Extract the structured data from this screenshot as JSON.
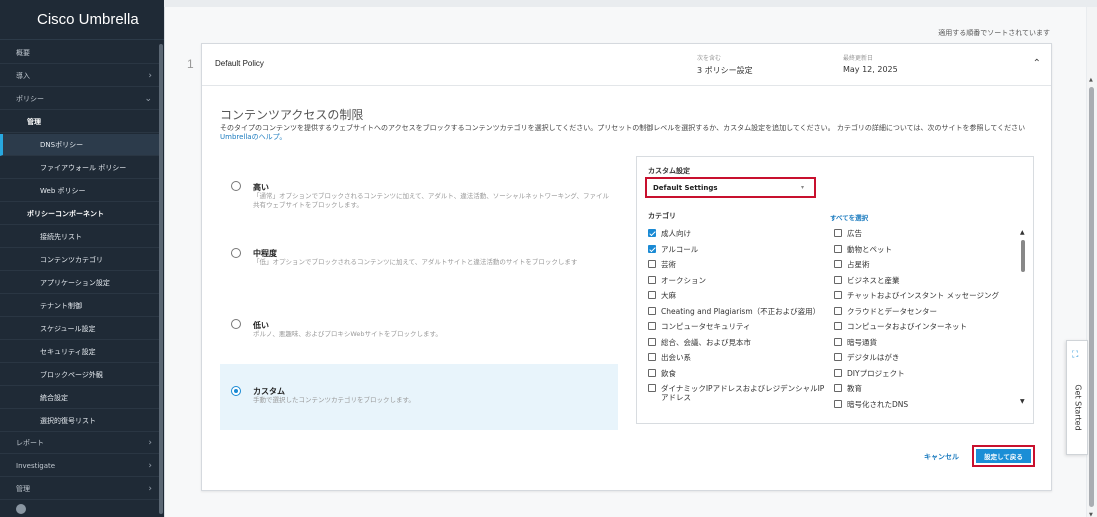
{
  "sidebar": {
    "brand": "Cisco Umbrella",
    "items": [
      {
        "label": "概要"
      },
      {
        "label": "導入"
      },
      {
        "label": "ポリシー"
      },
      {
        "label": "管理"
      },
      {
        "label": "DNSポリシー"
      },
      {
        "label": "ファイアウォール ポリシー"
      },
      {
        "label": "Web ポリシー"
      },
      {
        "label": "ポリシーコンポーネント"
      },
      {
        "label": "接続先リスト"
      },
      {
        "label": "コンテンツカテゴリ"
      },
      {
        "label": "アプリケーション設定"
      },
      {
        "label": "テナント制御"
      },
      {
        "label": "スケジュール設定"
      },
      {
        "label": "セキュリティ設定"
      },
      {
        "label": "ブロックページ外観"
      },
      {
        "label": "統合設定"
      },
      {
        "label": "選択的復号リスト"
      },
      {
        "label": "レポート"
      },
      {
        "label": "Investigate"
      },
      {
        "label": "管理"
      }
    ]
  },
  "main": {
    "sort_note": "適用する順番でソートされています",
    "row_number": "1",
    "policy": {
      "name": "Default Policy",
      "contains_label": "次を含む",
      "contains_value": "3 ポリシー設定",
      "updated_label": "最終更新日",
      "updated_value": "May 12, 2025"
    },
    "section": {
      "title": "コンテンツアクセスの制限",
      "desc": "そのタイプのコンテンツを提供するウェブサイトへのアクセスをブロックするコンテンツカテゴリを選択してください。プリセットの制御レベルを選択するか、カスタム設定を追加してください。 カテゴリの詳細については、次のサイトを参照してください",
      "link": "Umbrellaのヘルプ。"
    },
    "levels": [
      {
        "name": "高い",
        "desc": "「通常」オプションでブロックされるコンテンツに加えて、アダルト、違法活動、ソーシャルネットワーキング、ファイル共有ウェブサイトをブロックします。",
        "selected": false
      },
      {
        "name": "中程度",
        "desc": "「低」オプションでブロックされるコンテンツに加えて、アダルトサイトと違法活動のサイトをブロックします",
        "selected": false
      },
      {
        "name": "低い",
        "desc": "ポルノ、悪趣味、およびプロキシWebサイトをブロックします。",
        "selected": false
      },
      {
        "name": "カスタム",
        "desc": "手動で選択したコンテンツカテゴリをブロックします。",
        "selected": true
      }
    ],
    "custom_label": "カスタム設定",
    "custom_value": "Default Settings",
    "category_label": "カテゴリ",
    "select_all": "すべてを選択",
    "categories_left": [
      {
        "label": "成人向け",
        "checked": true
      },
      {
        "label": "アルコール",
        "checked": true
      },
      {
        "label": "芸術",
        "checked": false
      },
      {
        "label": "オークション",
        "checked": false
      },
      {
        "label": "大麻",
        "checked": false
      },
      {
        "label": "Cheating and Plagiarism（不正および盗用）",
        "checked": false
      },
      {
        "label": "コンピュータセキュリティ",
        "checked": false
      },
      {
        "label": "総合、会議、および見本市",
        "checked": false
      },
      {
        "label": "出会い系",
        "checked": false
      },
      {
        "label": "飲食",
        "checked": false
      },
      {
        "label": "ダイナミックIPアドレスおよびレジデンシャルIPアドレス",
        "checked": false
      }
    ],
    "categories_right": [
      {
        "label": "広告",
        "checked": false
      },
      {
        "label": "動物とペット",
        "checked": false
      },
      {
        "label": "占星術",
        "checked": false
      },
      {
        "label": "ビジネスと産業",
        "checked": false
      },
      {
        "label": "チャットおよびインスタント メッセージング",
        "checked": false
      },
      {
        "label": "クラウドとデータセンター",
        "checked": false
      },
      {
        "label": "コンピュータおよびインターネット",
        "checked": false
      },
      {
        "label": "暗号通貨",
        "checked": false
      },
      {
        "label": "デジタルはがき",
        "checked": false
      },
      {
        "label": "DIYプロジェクト",
        "checked": false
      },
      {
        "label": "教育",
        "checked": false
      },
      {
        "label": "暗号化されたDNS",
        "checked": false
      }
    ],
    "cancel": "キャンセル",
    "save": "設定して戻る"
  },
  "get_started": "Get Started",
  "colors": {
    "accent": "#1b8ed6",
    "highlight": "#c8102e",
    "sidebar": "#1f2a36"
  }
}
